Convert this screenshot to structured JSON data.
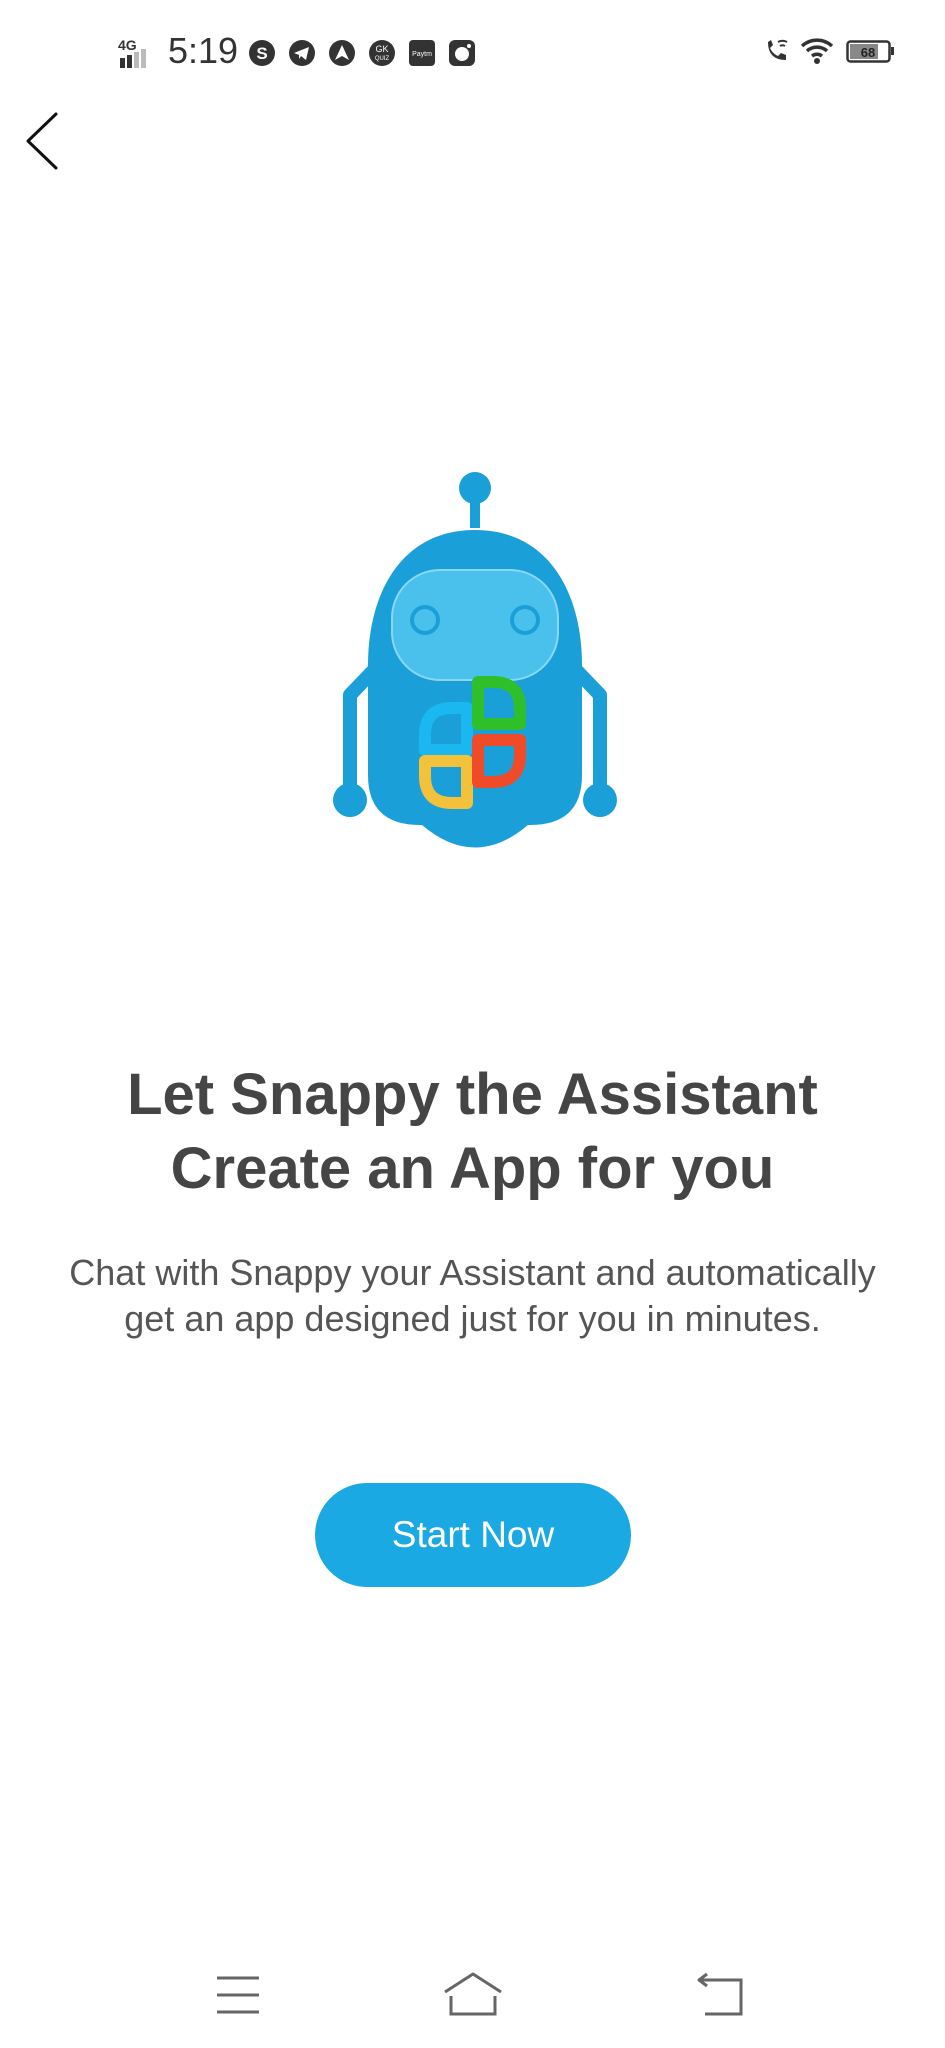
{
  "status_bar": {
    "network": "4G",
    "time": "5:19",
    "battery": "68",
    "notification_icons": [
      "skype-icon",
      "telegram-icon",
      "arrow-app-icon",
      "gk-quiz-icon",
      "paytm-icon",
      "camera-app-icon"
    ],
    "gk_label": "GK",
    "quiz_label": "QUIZ",
    "paytm_label": "Paytm"
  },
  "header": {
    "back_icon": "chevron-left-icon"
  },
  "content": {
    "headline_line1": "Let Snappy the Assistant",
    "headline_line2": "Create an App for you",
    "description": "Chat with Snappy your Assistant and automatically get an app designed just for you in minutes.",
    "start_button_label": "Start Now"
  },
  "nav_bar": {
    "items": [
      "menu-icon",
      "home-icon",
      "back-icon"
    ]
  },
  "colors": {
    "accent": "#1aa9e2",
    "robot_body": "#1b9fd8",
    "robot_face": "#49c1ec",
    "text_dark": "#454545",
    "logo_blue": "#1bb7f0",
    "logo_green": "#2fbf2a",
    "logo_yellow": "#f3c23a",
    "logo_red": "#f04b28"
  }
}
